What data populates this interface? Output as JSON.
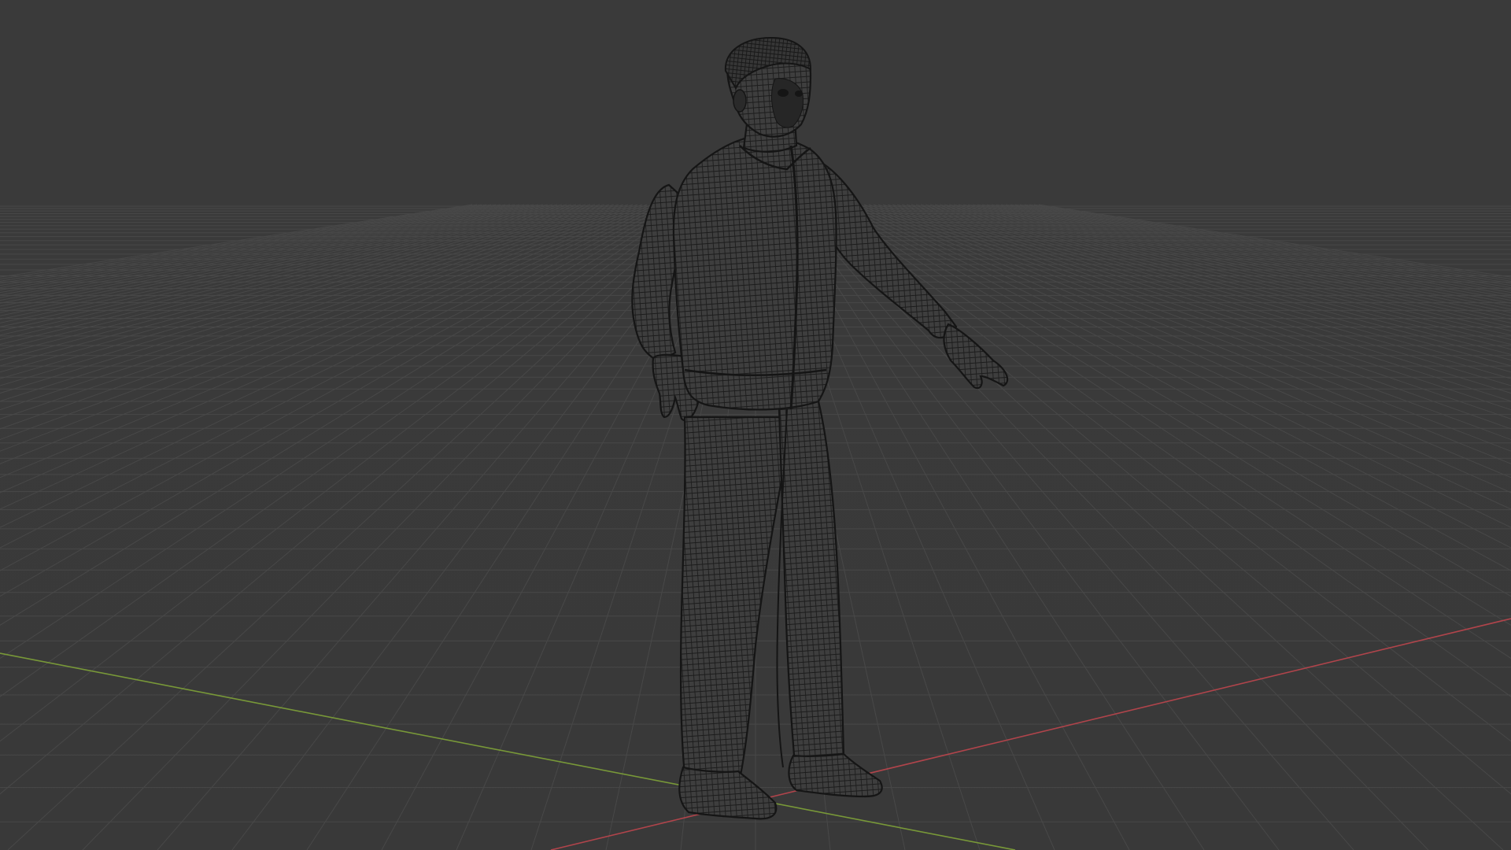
{
  "viewport": {
    "mode": "wireframe",
    "background_color": "#393939",
    "grid_color": "#4a4a4a",
    "x_axis_color": "#b8484f",
    "y_axis_color": "#7a9a3a",
    "wire_color": "#1a1a1a",
    "body_fill_color": "#3d3d3d"
  },
  "scene": {
    "object": "human-character-mesh",
    "pose": "a-pose"
  }
}
